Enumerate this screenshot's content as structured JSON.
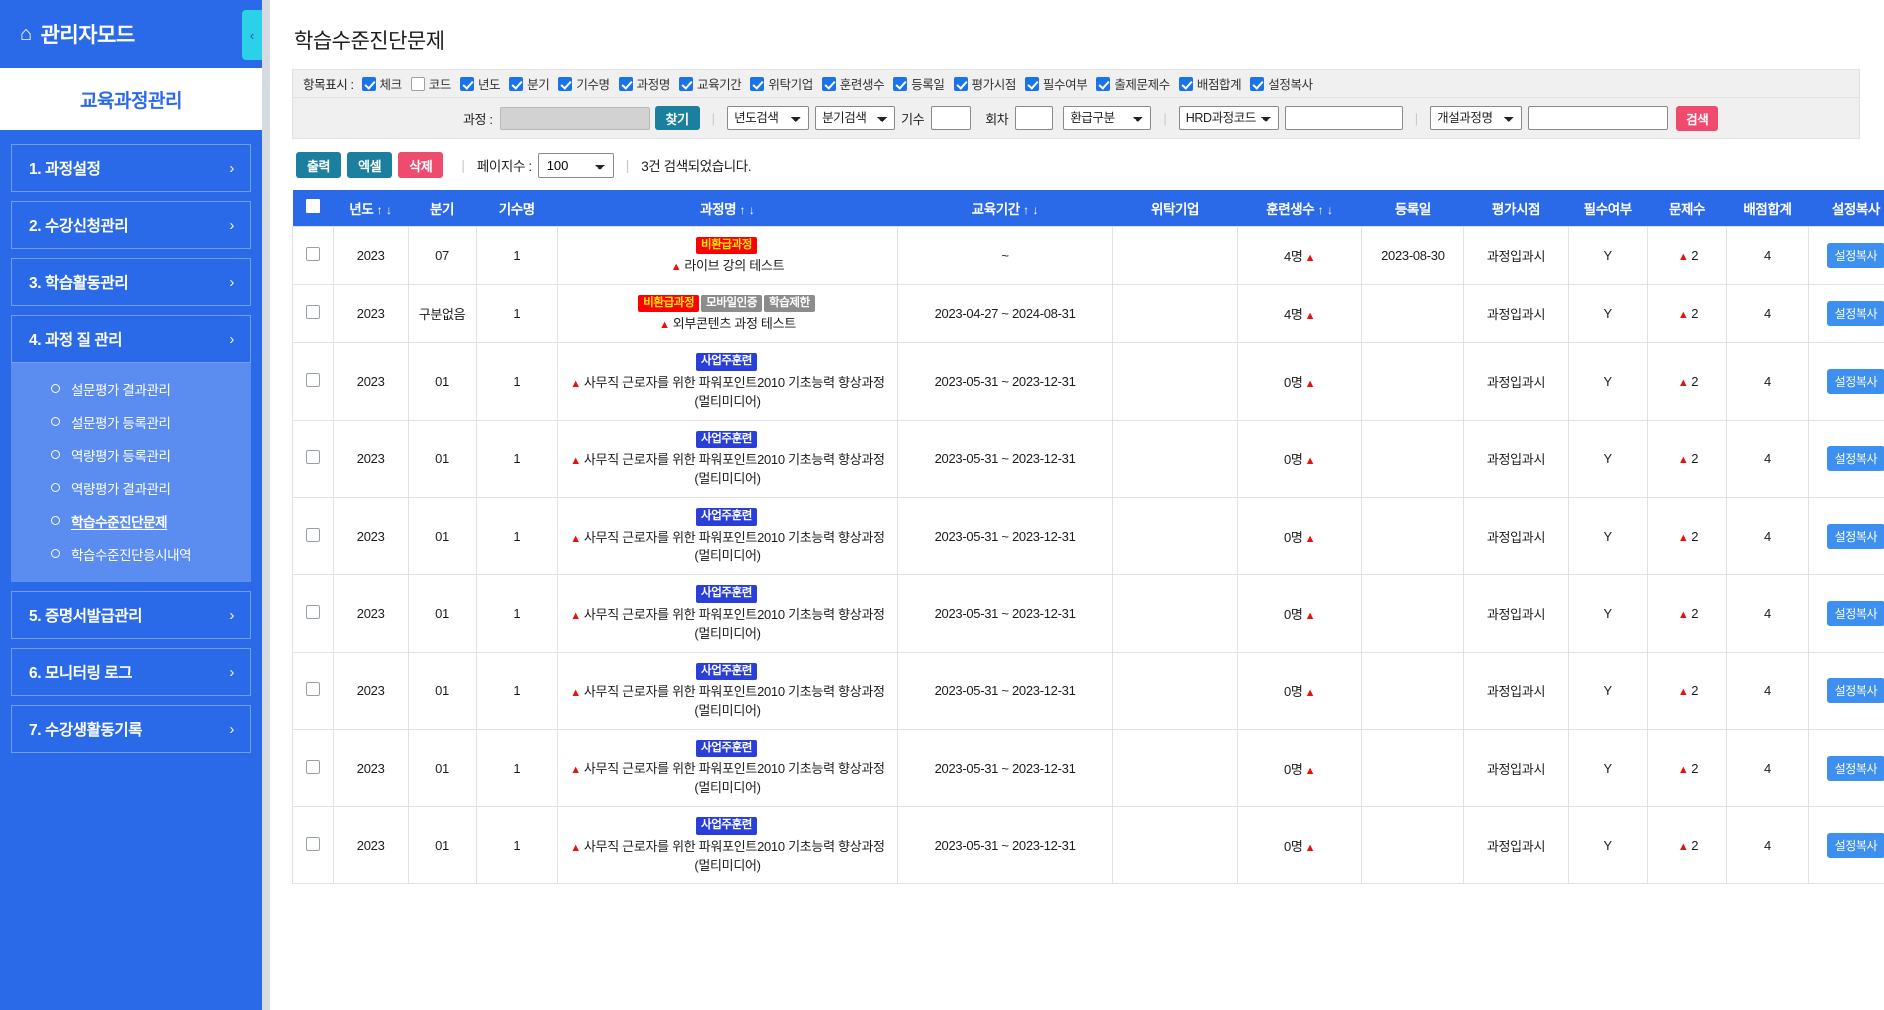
{
  "sidebar": {
    "brand": "관리자모드",
    "home_icon": "home-icon",
    "collapse_icon": "‹",
    "section_title": "교육과정관리",
    "menu": [
      {
        "label": "1. 과정설정",
        "chevron": "›"
      },
      {
        "label": "2. 수강신청관리",
        "chevron": "›"
      },
      {
        "label": "3. 학습활동관리",
        "chevron": "›"
      },
      {
        "label": "4. 과정 질 관리",
        "chevron": "›",
        "children": [
          {
            "label": "설문평가 결과관리",
            "active": false
          },
          {
            "label": "설문평가 등록관리",
            "active": false
          },
          {
            "label": "역량평가 등록관리",
            "active": false
          },
          {
            "label": "역량평가 결과관리",
            "active": false
          },
          {
            "label": "학습수준진단문제",
            "active": true
          },
          {
            "label": "학습수준진단응시내역",
            "active": false
          }
        ]
      },
      {
        "label": "5. 증명서발급관리",
        "chevron": "›"
      },
      {
        "label": "6. 모니터링 로그",
        "chevron": "›"
      },
      {
        "label": "7. 수강생활동기록",
        "chevron": "›"
      }
    ]
  },
  "page": {
    "title": "학습수준진단문제"
  },
  "display_bar": {
    "lead": "항목표시 :",
    "items": [
      {
        "label": "체크",
        "checked": true
      },
      {
        "label": "코드",
        "checked": false
      },
      {
        "label": "년도",
        "checked": true
      },
      {
        "label": "분기",
        "checked": true
      },
      {
        "label": "기수명",
        "checked": true
      },
      {
        "label": "과정명",
        "checked": true
      },
      {
        "label": "교육기간",
        "checked": true
      },
      {
        "label": "위탁기업",
        "checked": true
      },
      {
        "label": "훈련생수",
        "checked": true
      },
      {
        "label": "등록일",
        "checked": true
      },
      {
        "label": "평가시점",
        "checked": true
      },
      {
        "label": "필수여부",
        "checked": true
      },
      {
        "label": "출제문제수",
        "checked": true
      },
      {
        "label": "배점합계",
        "checked": true
      },
      {
        "label": "설정복사",
        "checked": true
      }
    ]
  },
  "toolbar": {
    "course_label": "과정 :",
    "course_value": "",
    "find_button": "찾기",
    "year_select": "년도검색",
    "quarter_select": "분기검색",
    "cohort_label": "기수",
    "cohort_value": "",
    "round_label": "회차",
    "round_value": "",
    "refund_select": "환급구분",
    "hrd_select": "HRD과정코드",
    "hrd_value": "",
    "course_open_select": "개설과정명",
    "course_open_value": "",
    "search_button": "검색"
  },
  "actions": {
    "print": "출력",
    "excel": "엑셀",
    "delete": "삭제",
    "page_size_label": "페이지수 :",
    "page_size_value": "100",
    "result_count": "3건 검색되었습니다."
  },
  "table": {
    "columns": [
      {
        "key": "check",
        "label": "",
        "sort": false
      },
      {
        "key": "year",
        "label": "년도",
        "sort": true
      },
      {
        "key": "quarter",
        "label": "분기",
        "sort": false
      },
      {
        "key": "cohort",
        "label": "기수명",
        "sort": false
      },
      {
        "key": "course",
        "label": "과정명",
        "sort": true
      },
      {
        "key": "period",
        "label": "교육기간",
        "sort": true
      },
      {
        "key": "company",
        "label": "위탁기업",
        "sort": false
      },
      {
        "key": "trainees",
        "label": "훈련생수",
        "sort": true
      },
      {
        "key": "regdate",
        "label": "등록일",
        "sort": false
      },
      {
        "key": "evalpt",
        "label": "평가시점",
        "sort": false
      },
      {
        "key": "required",
        "label": "필수여부",
        "sort": false
      },
      {
        "key": "qcount",
        "label": "문제수",
        "sort": false
      },
      {
        "key": "score",
        "label": "배점합계",
        "sort": false
      },
      {
        "key": "copy",
        "label": "설정복사",
        "sort": false
      }
    ],
    "sort_asc": "↑",
    "sort_desc": "↓",
    "copy_button_label": "설정복사",
    "rows": [
      {
        "year": "2023",
        "quarter": "07",
        "cohort": "1",
        "badges": [
          {
            "text": "비환급과정",
            "style": "red"
          }
        ],
        "course": "라이브 강의 테스트",
        "period": "~",
        "company": "",
        "trainees": "4명",
        "trainees_mark": "▲",
        "regdate": "2023-08-30",
        "evalpt": "과정입과시",
        "required": "Y",
        "qcount": "2",
        "qcount_mark": "▲",
        "score": "4"
      },
      {
        "year": "2023",
        "quarter": "구분없음",
        "cohort": "1",
        "badges": [
          {
            "text": "비환급과정",
            "style": "red"
          },
          {
            "text": "모바일인증",
            "style": "gray"
          },
          {
            "text": "학습제한",
            "style": "gray"
          }
        ],
        "course": "외부콘텐츠 과정 테스트",
        "period": "2023-04-27 ~ 2024-08-31",
        "company": "",
        "trainees": "4명",
        "trainees_mark": "▲",
        "regdate": "",
        "evalpt": "과정입과시",
        "required": "Y",
        "qcount": "2",
        "qcount_mark": "▲",
        "score": "4"
      },
      {
        "year": "2023",
        "quarter": "01",
        "cohort": "1",
        "badges": [
          {
            "text": "사업주훈련",
            "style": "blue"
          }
        ],
        "course": "사무직 근로자를 위한 파워포인트2010 기초능력 향상과정(멀티미디어)",
        "period": "2023-05-31 ~ 2023-12-31",
        "company": "",
        "trainees": "0명",
        "trainees_mark": "▲",
        "regdate": "",
        "evalpt": "과정입과시",
        "required": "Y",
        "qcount": "2",
        "qcount_mark": "▲",
        "score": "4"
      },
      {
        "year": "2023",
        "quarter": "01",
        "cohort": "1",
        "badges": [
          {
            "text": "사업주훈련",
            "style": "blue"
          }
        ],
        "course": "사무직 근로자를 위한 파워포인트2010 기초능력 향상과정(멀티미디어)",
        "period": "2023-05-31 ~ 2023-12-31",
        "company": "",
        "trainees": "0명",
        "trainees_mark": "▲",
        "regdate": "",
        "evalpt": "과정입과시",
        "required": "Y",
        "qcount": "2",
        "qcount_mark": "▲",
        "score": "4"
      },
      {
        "year": "2023",
        "quarter": "01",
        "cohort": "1",
        "badges": [
          {
            "text": "사업주훈련",
            "style": "blue"
          }
        ],
        "course": "사무직 근로자를 위한 파워포인트2010 기초능력 향상과정(멀티미디어)",
        "period": "2023-05-31 ~ 2023-12-31",
        "company": "",
        "trainees": "0명",
        "trainees_mark": "▲",
        "regdate": "",
        "evalpt": "과정입과시",
        "required": "Y",
        "qcount": "2",
        "qcount_mark": "▲",
        "score": "4"
      },
      {
        "year": "2023",
        "quarter": "01",
        "cohort": "1",
        "badges": [
          {
            "text": "사업주훈련",
            "style": "blue"
          }
        ],
        "course": "사무직 근로자를 위한 파워포인트2010 기초능력 향상과정(멀티미디어)",
        "period": "2023-05-31 ~ 2023-12-31",
        "company": "",
        "trainees": "0명",
        "trainees_mark": "▲",
        "regdate": "",
        "evalpt": "과정입과시",
        "required": "Y",
        "qcount": "2",
        "qcount_mark": "▲",
        "score": "4"
      },
      {
        "year": "2023",
        "quarter": "01",
        "cohort": "1",
        "badges": [
          {
            "text": "사업주훈련",
            "style": "blue"
          }
        ],
        "course": "사무직 근로자를 위한 파워포인트2010 기초능력 향상과정(멀티미디어)",
        "period": "2023-05-31 ~ 2023-12-31",
        "company": "",
        "trainees": "0명",
        "trainees_mark": "▲",
        "regdate": "",
        "evalpt": "과정입과시",
        "required": "Y",
        "qcount": "2",
        "qcount_mark": "▲",
        "score": "4"
      },
      {
        "year": "2023",
        "quarter": "01",
        "cohort": "1",
        "badges": [
          {
            "text": "사업주훈련",
            "style": "blue"
          }
        ],
        "course": "사무직 근로자를 위한 파워포인트2010 기초능력 향상과정(멀티미디어)",
        "period": "2023-05-31 ~ 2023-12-31",
        "company": "",
        "trainees": "0명",
        "trainees_mark": "▲",
        "regdate": "",
        "evalpt": "과정입과시",
        "required": "Y",
        "qcount": "2",
        "qcount_mark": "▲",
        "score": "4"
      },
      {
        "year": "2023",
        "quarter": "01",
        "cohort": "1",
        "badges": [
          {
            "text": "사업주훈련",
            "style": "blue"
          }
        ],
        "course": "사무직 근로자를 위한 파워포인트2010 기초능력 향상과정(멀티미디어)",
        "period": "2023-05-31 ~ 2023-12-31",
        "company": "",
        "trainees": "0명",
        "trainees_mark": "▲",
        "regdate": "",
        "evalpt": "과정입과시",
        "required": "Y",
        "qcount": "2",
        "qcount_mark": "▲",
        "score": "4"
      }
    ]
  },
  "colors": {
    "brand_blue": "#2a6ae8",
    "accent_cyan": "#2ad1e8",
    "danger_pink": "#ef4b6e",
    "teal": "#1b7fa0",
    "badge_red": "#ff0000",
    "badge_gray": "#8c8c8c",
    "badge_blue": "#2a3fd8"
  }
}
